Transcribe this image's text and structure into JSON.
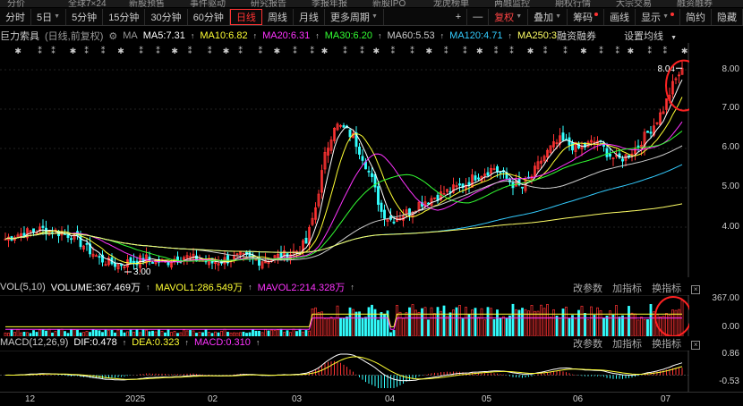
{
  "topbar": [
    "分价",
    "全球7×24",
    "新股预售",
    "事件驱动",
    "研究报告",
    "季报年报",
    "新股IPO",
    "龙虎榜单",
    "两融监控",
    "期权行情",
    "大宗交易",
    "融资融券"
  ],
  "toolbar": {
    "periods": [
      "分时",
      "5日",
      "5分钟",
      "15分钟",
      "30分钟",
      "60分钟",
      "日线",
      "周线",
      "月线",
      "更多周期"
    ],
    "active": "日线",
    "right": [
      "+",
      "—",
      "复权",
      "叠加",
      "筹码",
      "画线",
      "显示",
      "简约",
      "隐藏"
    ]
  },
  "legend": {
    "name": "巨力索具",
    "mode": "(日线,前复权)",
    "ma5": "MA5:7.31",
    "ma10": "MA10:6.82",
    "ma20": "MA20:6.31",
    "ma30": "MA30:6.20",
    "ma60": "MA60:5.53",
    "ma120": "MA120:4.71",
    "ma250": "MA250:3",
    "extra": "融资融券",
    "settings": "设置均线",
    "colors": {
      "ma5": "#ffffff",
      "ma10": "#ffff33",
      "ma20": "#ff33ff",
      "ma30": "#33ff33",
      "ma60": "#cccccc",
      "ma120": "#33ccff",
      "ma250": "#ffff66"
    }
  },
  "price_axis": [
    "8.00",
    "7.00",
    "6.00",
    "5.00",
    "4.00"
  ],
  "high_label": "8.04",
  "low_label": "3.00",
  "vol": {
    "label": "VOL(5,10)",
    "volume": "VOLUME:367.469万",
    "mavol1": "MAVOL1:286.549万",
    "mavol2": "MAVOL2:214.328万",
    "axis": [
      "367.00",
      "0.00"
    ]
  },
  "macd": {
    "label": "MACD(12,26,9)",
    "dif": "DIF:0.478",
    "dea": "DEA:0.323",
    "macd": "MACD:0.310",
    "axis": [
      "0.86",
      "-0.53"
    ]
  },
  "sub_controls": [
    "改参数",
    "加指标",
    "换指标"
  ],
  "xaxis": [
    "12",
    "2025",
    "02",
    "03",
    "04",
    "05",
    "06",
    "07"
  ],
  "chart_data": {
    "type": "candlestick",
    "price_range": [
      3.0,
      8.5
    ],
    "price_series": [
      3.7,
      3.8,
      3.85,
      3.9,
      3.95,
      3.9,
      3.85,
      3.8,
      3.6,
      3.4,
      3.2,
      3.1,
      3.05,
      3.1,
      3.15,
      3.2,
      3.15,
      3.1,
      3.2,
      3.25,
      3.2,
      3.15,
      3.1,
      3.15,
      3.2,
      3.25,
      3.2,
      3.15,
      3.2,
      3.25,
      3.3,
      3.4,
      3.6,
      4.5,
      5.8,
      6.6,
      6.5,
      6.3,
      5.8,
      5.2,
      4.4,
      4.2,
      4.3,
      4.4,
      4.6,
      4.7,
      4.8,
      4.9,
      5.0,
      5.1,
      5.3,
      5.4,
      5.5,
      5.3,
      5.1,
      5.0,
      5.3,
      5.7,
      6.0,
      6.2,
      6.1,
      6.0,
      6.1,
      6.2,
      5.9,
      5.7,
      5.8,
      6.0,
      6.3,
      6.6,
      7.0,
      7.6,
      8.04
    ],
    "volume_max": 367.0,
    "macd_range": [
      -0.53,
      0.86
    ]
  }
}
